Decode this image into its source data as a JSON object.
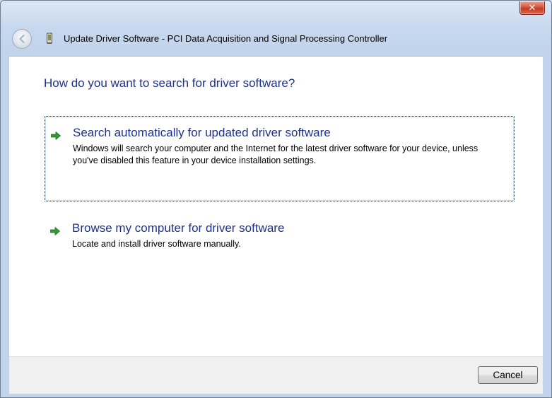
{
  "window": {
    "title": "Update Driver Software - PCI Data Acquisition and Signal Processing Controller",
    "close_glyph": "✕"
  },
  "content": {
    "heading": "How do you want to search for driver software?",
    "options": [
      {
        "title": "Search automatically for updated driver software",
        "description": "Windows will search your computer and the Internet for the latest driver software for your device, unless you've disabled this feature in your device installation settings.",
        "icon": "green-arrow-icon",
        "focused": true
      },
      {
        "title": "Browse my computer for driver software",
        "description": "Locate and install driver software manually.",
        "icon": "green-arrow-icon",
        "focused": false
      }
    ]
  },
  "footer": {
    "cancel_label": "Cancel"
  },
  "colors": {
    "heading": "#1e3287",
    "arrow_green": "#2f9a2f",
    "window_frame": "#c7d8ee"
  }
}
